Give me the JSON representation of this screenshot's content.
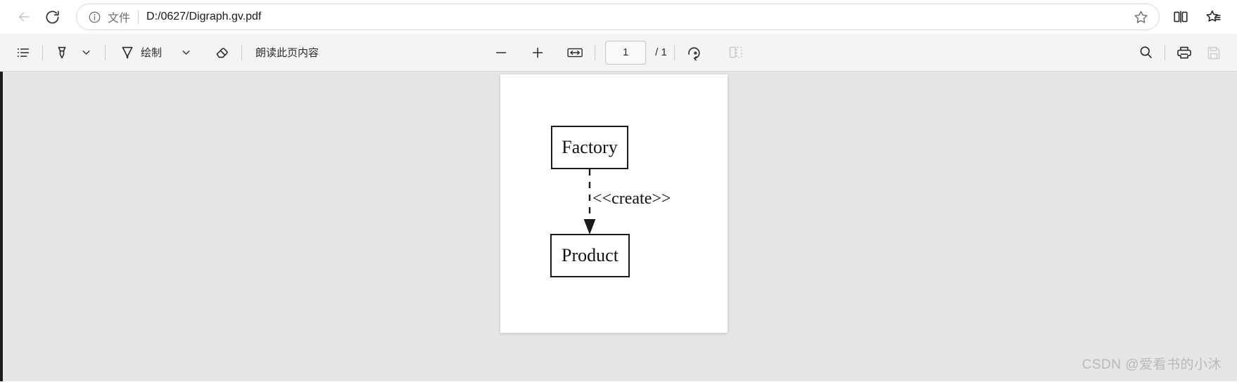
{
  "browser": {
    "back_button": "Back",
    "reload_button": "Reload",
    "omnibox": {
      "kind_label": "文件",
      "url": "D:/0627/Digraph.gv.pdf",
      "star_title": "收藏"
    },
    "right_buttons": [
      {
        "name": "split-screen-button",
        "title": "拆分屏幕"
      },
      {
        "name": "collections-button",
        "title": "收藏夹"
      }
    ]
  },
  "pdf_toolbar": {
    "left": {
      "toc_button": "目录",
      "highlighter_button": "荧光笔",
      "highlighter_dropdown": "⌄",
      "draw_label": "绘制",
      "draw_dropdown": "⌄",
      "erase_button": "擦除",
      "read_aloud_label": "朗读此页内容"
    },
    "center": {
      "zoom_out": "−",
      "zoom_in": "+",
      "fit_width": "适应宽度",
      "page_number": "1",
      "page_total": "/ 1",
      "rotate": "旋转"
    },
    "right": {
      "search_button": "搜索",
      "print_button": "打印",
      "save_button": "保存"
    }
  },
  "document": {
    "diagram": {
      "type": "uml-class-diagram",
      "nodes": [
        {
          "id": "factory",
          "label": "Factory"
        },
        {
          "id": "product",
          "label": "Product"
        }
      ],
      "edges": [
        {
          "from": "factory",
          "to": "product",
          "label": "<<create>>",
          "style": "dashed",
          "arrow": "filled-triangle"
        }
      ]
    }
  },
  "watermark": "CSDN @爱看书的小沐",
  "colors": {
    "toolbar_bg": "#f4f4f4",
    "viewer_bg": "#e6e6e6",
    "page_bg": "#ffffff",
    "ink": "#1a1a1a",
    "watermark": "#b9b9b9"
  }
}
